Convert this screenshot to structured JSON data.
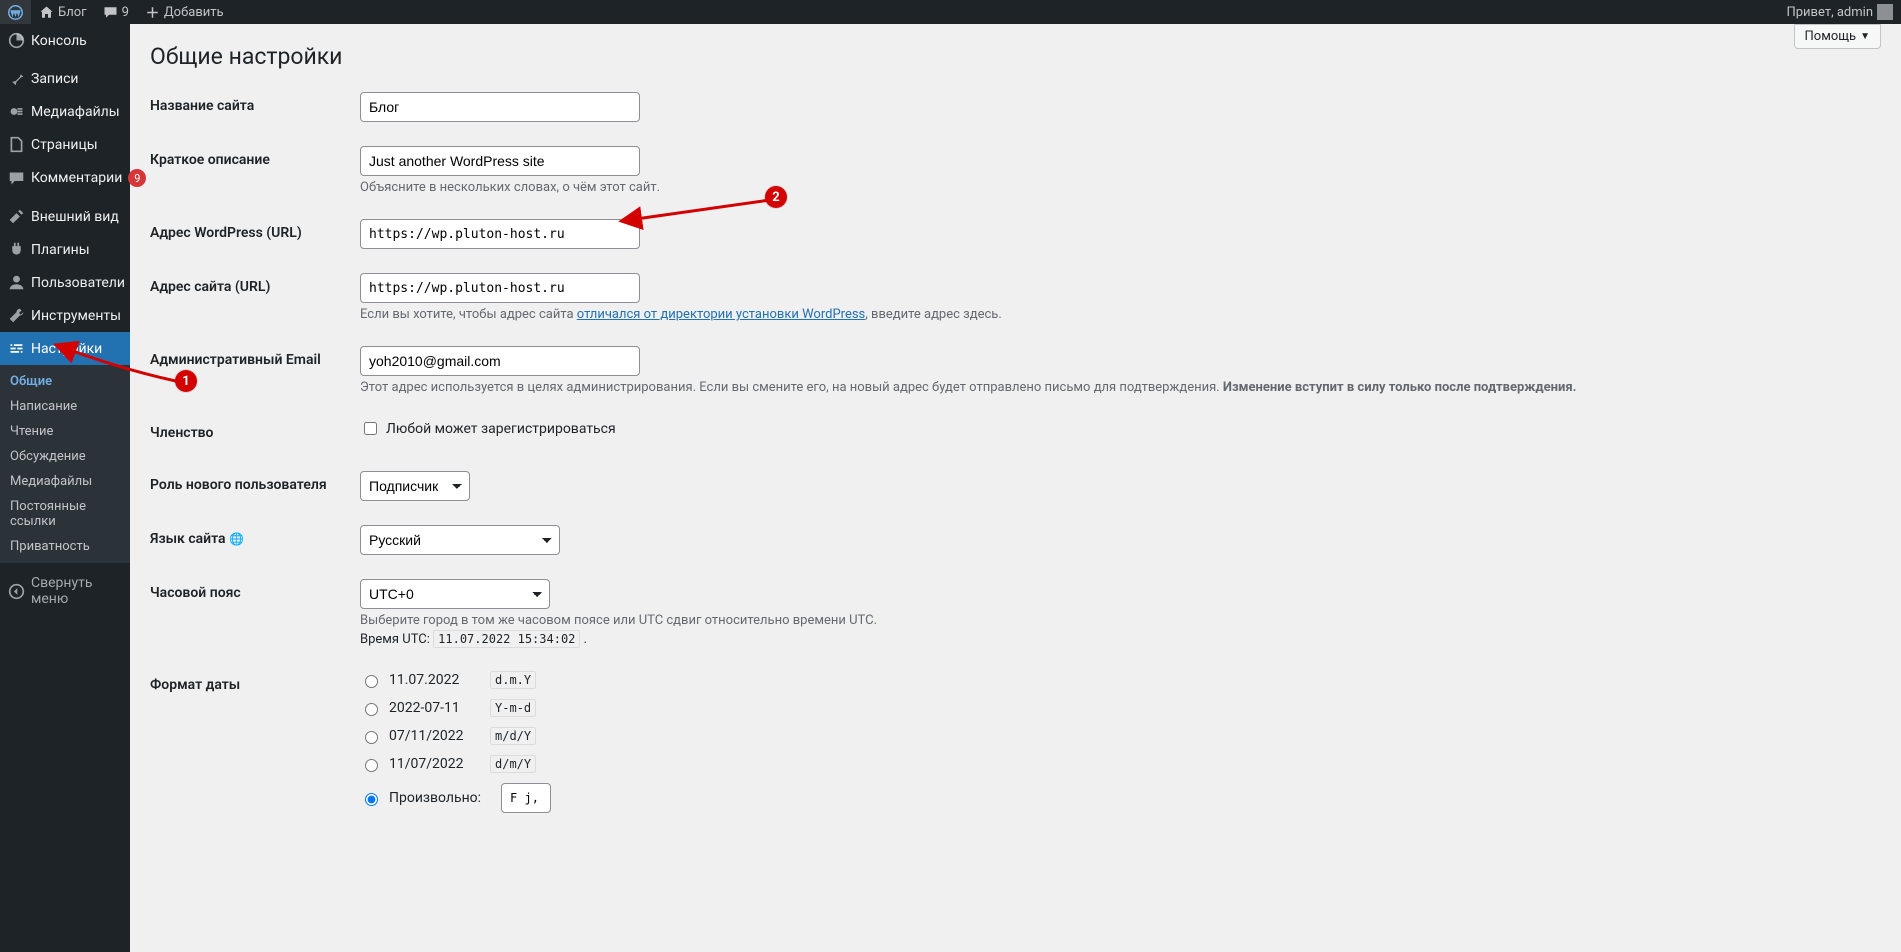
{
  "adminbar": {
    "site_name": "Блог",
    "comments_count": "9",
    "add_new": "Добавить",
    "greeting": "Привет, admin"
  },
  "sidebar": {
    "items": [
      {
        "icon": "dashboard",
        "label": "Консоль"
      },
      {
        "icon": "pin",
        "label": "Записи"
      },
      {
        "icon": "media",
        "label": "Медиафайлы"
      },
      {
        "icon": "page",
        "label": "Страницы"
      },
      {
        "icon": "comments",
        "label": "Комментарии",
        "badge": "9"
      },
      {
        "icon": "appearance",
        "label": "Внешний вид"
      },
      {
        "icon": "plugins",
        "label": "Плагины"
      },
      {
        "icon": "users",
        "label": "Пользователи"
      },
      {
        "icon": "tools",
        "label": "Инструменты"
      },
      {
        "icon": "settings",
        "label": "Настройки",
        "current": true
      }
    ],
    "submenu": [
      {
        "label": "Общие",
        "current": true
      },
      {
        "label": "Написание"
      },
      {
        "label": "Чтение"
      },
      {
        "label": "Обсуждение"
      },
      {
        "label": "Медиафайлы"
      },
      {
        "label": "Постоянные ссылки"
      },
      {
        "label": "Приватность"
      }
    ],
    "collapse": "Свернуть меню"
  },
  "help": {
    "label": "Помощь"
  },
  "page": {
    "title": "Общие настройки",
    "rows": {
      "blogname_label": "Название сайта",
      "blogname_value": "Блог",
      "blogdesc_label": "Краткое описание",
      "blogdesc_value": "Just another WordPress site",
      "blogdesc_help": "Объясните в нескольких словах, о чём этот сайт.",
      "siteurl_label": "Адрес WordPress (URL)",
      "siteurl_value": "https://wp.pluton-host.ru",
      "home_label": "Адрес сайта (URL)",
      "home_value": "https://wp.pluton-host.ru",
      "home_help_pre": "Если вы хотите, чтобы адрес сайта ",
      "home_help_link": "отличался от директории установки WordPress",
      "home_help_post": ", введите адрес здесь.",
      "email_label": "Административный Email",
      "email_value": "yoh2010@gmail.com",
      "email_help_pre": "Этот адрес используется в целях администрирования. Если вы смените его, на новый адрес будет отправлено письмо для подтверждения. ",
      "email_help_bold": "Изменение вступит в силу только после подтверждения.",
      "membership_label": "Членство",
      "membership_cb": "Любой может зарегистрироваться",
      "role_label": "Роль нового пользователя",
      "role_value": "Подписчик",
      "lang_label": "Язык сайта",
      "lang_value": "Русский",
      "tz_label": "Часовой пояс",
      "tz_value": "UTC+0",
      "tz_help": "Выберите город в том же часовом поясе или UTC сдвиг относительно времени UTC.",
      "tz_utc_pre": "Время UTC: ",
      "tz_utc_code": "11.07.2022 15:34:02",
      "tz_utc_post": " .",
      "df_label": "Формат даты",
      "df_opts": [
        {
          "display": "11.07.2022",
          "code": "d.m.Y",
          "checked": false
        },
        {
          "display": "2022-07-11",
          "code": "Y-m-d",
          "checked": false
        },
        {
          "display": "07/11/2022",
          "code": "m/d/Y",
          "checked": false
        },
        {
          "display": "11/07/2022",
          "code": "d/m/Y",
          "checked": false
        }
      ],
      "df_custom_label": "Произвольно:",
      "df_custom_value": "F j, Y"
    }
  },
  "annotations": {
    "one": "1",
    "two": "2"
  }
}
